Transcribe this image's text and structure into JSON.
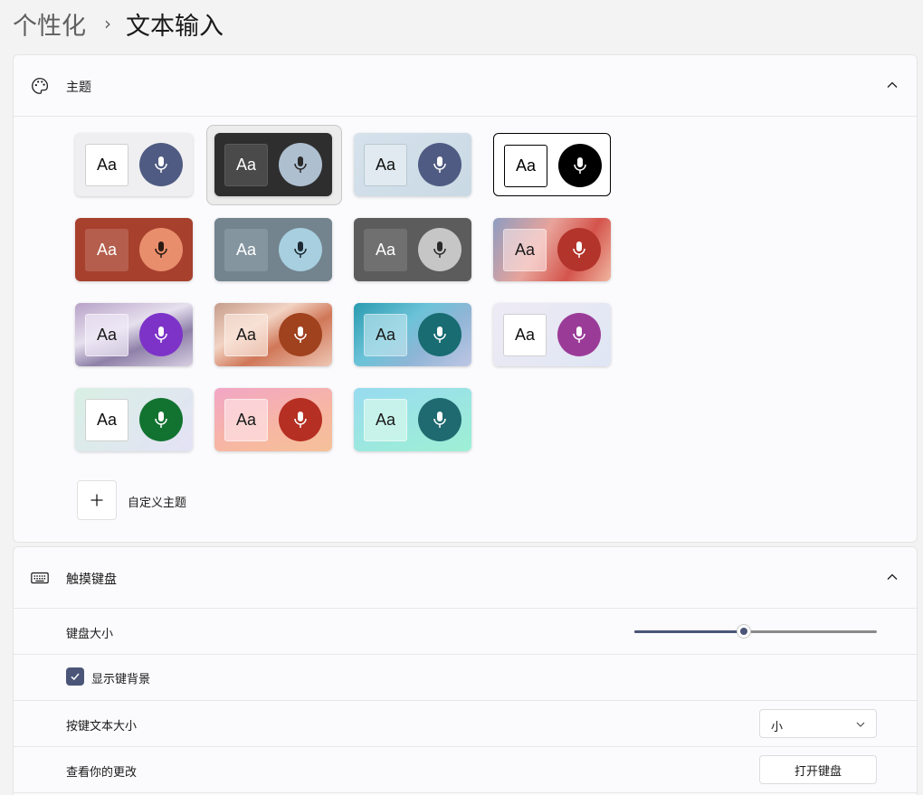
{
  "breadcrumb": {
    "parent": "个性化",
    "separator": "›",
    "current": "文本输入"
  },
  "theme_section": {
    "title": "主题",
    "icon": "palette-icon",
    "chevron": "chevron-up-icon",
    "custom_label": "自定义主题",
    "custom_icon": "plus-icon",
    "selected_index": 1,
    "tiles": [
      {
        "aa": "Aa",
        "tile_bg": "#efeff1",
        "aa_bg": "#ffffff",
        "aa_fg": "#111111",
        "aa_border": "#d0d0d0",
        "mic_bg": "#4f5b82",
        "mic_fg": "#ffffff"
      },
      {
        "aa": "Aa",
        "tile_bg": "#2e2e2e",
        "aa_bg": "#4a4a4a",
        "aa_fg": "#ffffff",
        "aa_border": "#5a5a5a",
        "mic_bg": "#aebfd0",
        "mic_fg": "#2a2a2a"
      },
      {
        "aa": "Aa",
        "tile_bg": "linear-gradient(135deg,#d6e2ec,#c9d9e4)",
        "aa_bg": "#e1eaf0",
        "aa_fg": "#111111",
        "aa_border": "#b8c8d3",
        "mic_bg": "#4f5b82",
        "mic_fg": "#ffffff"
      },
      {
        "aa": "Aa",
        "tile_bg": "#ffffff",
        "aa_bg": "#ffffff",
        "aa_fg": "#000000",
        "aa_border": "#000000",
        "mic_bg": "#000000",
        "mic_fg": "#ffffff",
        "tile_border": "#000000"
      },
      {
        "aa": "Aa",
        "tile_bg": "#a8402e",
        "aa_bg": "#b55e4d",
        "aa_fg": "#ffffff",
        "aa_border": "#b55e4d",
        "mic_bg": "#e98e6c",
        "mic_fg": "#2a1a14"
      },
      {
        "aa": "Aa",
        "tile_bg": "#73848e",
        "aa_bg": "#8595a0",
        "aa_fg": "#ffffff",
        "aa_border": "#8595a0",
        "mic_bg": "#a7cfdf",
        "mic_fg": "#1d2a33"
      },
      {
        "aa": "Aa",
        "tile_bg": "#5c5c5c",
        "aa_bg": "#707070",
        "aa_fg": "#ffffff",
        "aa_border": "#707070",
        "mic_bg": "#c6c6c6",
        "mic_fg": "#2a2a2a"
      },
      {
        "aa": "Aa",
        "tile_bg": "linear-gradient(120deg,#8d9dc2,#e8a39a 40%,#d4544c 70%,#f0b6a0)",
        "aa_bg": "rgba(255,235,235,0.55)",
        "aa_fg": "#1a1a1a",
        "aa_border": "rgba(255,255,255,0.4)",
        "mic_bg": "#b3342b",
        "mic_fg": "#ffffff"
      },
      {
        "aa": "Aa",
        "tile_bg": "linear-gradient(160deg,#b8a2c8,#e6e0ee 40%,#8e80a8 65%,#d8cfe2)",
        "aa_bg": "rgba(240,232,246,0.7)",
        "aa_fg": "#1a1a1a",
        "aa_border": "rgba(255,255,255,0.5)",
        "mic_bg": "#7d33c8",
        "mic_fg": "#ffffff"
      },
      {
        "aa": "Aa",
        "tile_bg": "linear-gradient(150deg,#c79d8c,#f2d4c4 35%,#d07758 60%,#eec7b5)",
        "aa_bg": "rgba(250,230,220,0.7)",
        "aa_fg": "#1a1a1a",
        "aa_border": "rgba(255,255,255,0.5)",
        "mic_bg": "#a0421e",
        "mic_fg": "#ffffff"
      },
      {
        "aa": "Aa",
        "tile_bg": "linear-gradient(140deg,#2a9bb0,#6cc3d8 40%,#8fb5d6 65%,#bfc6e4)",
        "aa_bg": "rgba(200,232,240,0.6)",
        "aa_fg": "#1a1a1a",
        "aa_border": "rgba(255,255,255,0.4)",
        "mic_bg": "#186c72",
        "mic_fg": "#ffffff"
      },
      {
        "aa": "Aa",
        "tile_bg": "linear-gradient(135deg,#eeeaf4,#dfe6f4)",
        "aa_bg": "#ffffff",
        "aa_fg": "#111111",
        "aa_border": "#d0d0d0",
        "mic_bg": "#9b3b98",
        "mic_fg": "#ffffff"
      },
      {
        "aa": "Aa",
        "tile_bg": "linear-gradient(135deg,#d8f0e4,#e4e2f6)",
        "aa_bg": "#ffffff",
        "aa_fg": "#111111",
        "aa_border": "#d0d0d0",
        "mic_bg": "#127331",
        "mic_fg": "#ffffff"
      },
      {
        "aa": "Aa",
        "tile_bg": "linear-gradient(160deg,#f2a6c6,#f7b7a2 60%,#f6c19a)",
        "aa_bg": "rgba(252,220,222,0.8)",
        "aa_fg": "#1a1a1a",
        "aa_border": "rgba(255,255,255,0.5)",
        "mic_bg": "#b52f22",
        "mic_fg": "#ffffff"
      },
      {
        "aa": "Aa",
        "tile_bg": "linear-gradient(160deg,#98dbf0,#9ef0d4)",
        "aa_bg": "rgba(210,246,236,0.8)",
        "aa_fg": "#1a1a1a",
        "aa_border": "rgba(255,255,255,0.5)",
        "mic_bg": "#1e6a70",
        "mic_fg": "#ffffff"
      }
    ]
  },
  "keyboard_section": {
    "title": "触摸键盘",
    "icon": "keyboard-icon",
    "chevron": "chevron-up-icon",
    "size_label": "键盘大小",
    "size_value": 0.45,
    "show_bg_label": "显示键背景",
    "show_bg_checked": true,
    "text_size_label": "按键文本大小",
    "text_size_value": "小",
    "preview_label": "查看你的更改",
    "open_button": "打开键盘"
  },
  "colors": {
    "accent": "#4a5578"
  }
}
